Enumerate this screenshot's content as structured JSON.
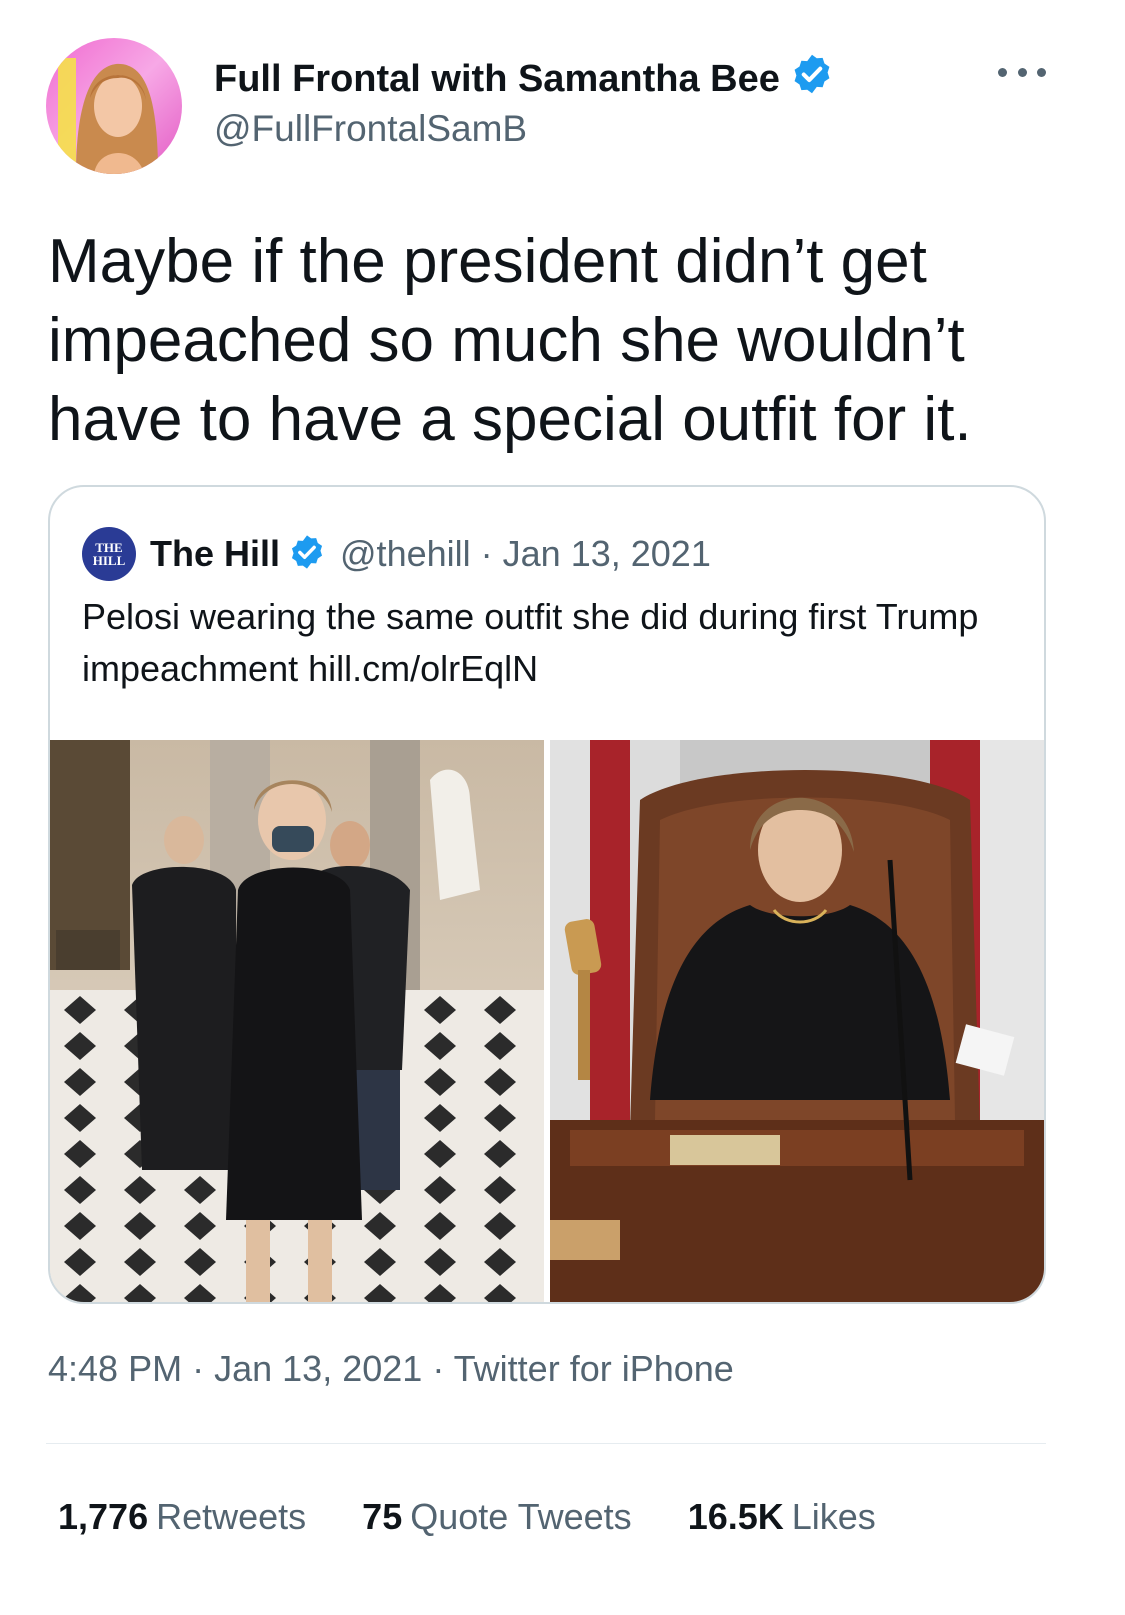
{
  "author": {
    "name": "Full Frontal with Samantha Bee",
    "handle": "@FullFrontalSamB",
    "verified": true,
    "avatar_icon": "person-portrait-avatar"
  },
  "tweet_text": "Maybe if the president didn’t get impeached so much she wouldn’t have to have a special outfit for it.",
  "quoted": {
    "avatar_text_line1": "THE",
    "avatar_text_line2": "HILL",
    "name": "The Hill",
    "verified": true,
    "handle": "@thehill",
    "separator": "·",
    "date": "Jan 13, 2021",
    "text": "Pelosi wearing the same outfit she did during first Trump impeachment",
    "link": "hill.cm/olrEqlN",
    "images": [
      {
        "icon": "photo-walking-in-hallway"
      },
      {
        "icon": "photo-speaker-with-gavel"
      }
    ]
  },
  "meta": {
    "time": "4:48 PM",
    "sep1": "·",
    "date": "Jan 13, 2021",
    "sep2": "·",
    "source": "Twitter for iPhone"
  },
  "stats": {
    "retweets_count": "1,776",
    "retweets_label": "Retweets",
    "quotes_count": "75",
    "quotes_label": "Quote Tweets",
    "likes_count": "16.5K",
    "likes_label": "Likes"
  },
  "colors": {
    "verified_blue": "#1d9bf0",
    "secondary_text": "#536471",
    "primary_text": "#0f1419",
    "border": "#cfd9de"
  }
}
